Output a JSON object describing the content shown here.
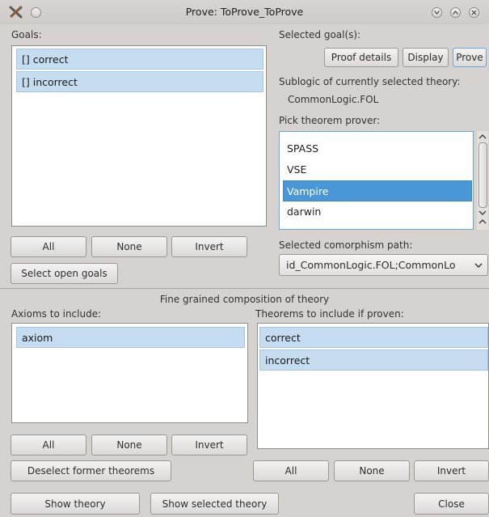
{
  "window": {
    "title": "Prove: ToProve_ToProve"
  },
  "goals": {
    "label": "Goals:",
    "items": [
      "[] correct",
      "[] incorrect"
    ],
    "buttons": {
      "all": "All",
      "none": "None",
      "invert": "Invert",
      "select_open": "Select open goals"
    }
  },
  "selected_goals": {
    "label": "Selected goal(s):",
    "buttons": {
      "proof_details": "Proof details",
      "display": "Display",
      "prove": "Prove"
    }
  },
  "sublogic": {
    "label": "Sublogic of currently selected theory:",
    "value": "CommonLogic.FOL"
  },
  "prover": {
    "label": "Pick theorem prover:",
    "items": [
      "SPASS",
      "VSE",
      "Vampire",
      "darwin"
    ],
    "selected": "Vampire"
  },
  "comorphism": {
    "label": "Selected comorphism path:",
    "value": "id_CommonLogic.FOL;CommonLo"
  },
  "composition": {
    "heading": "Fine grained composition of theory",
    "axioms_label": "Axioms to include:",
    "axioms": [
      "axiom"
    ],
    "axiom_buttons": {
      "all": "All",
      "none": "None",
      "invert": "Invert"
    },
    "deselect_former": "Deselect former theorems",
    "theorems_label": "Theorems to include if proven:",
    "theorems": [
      "correct",
      "incorrect"
    ],
    "theorem_buttons": {
      "all": "All",
      "none": "None",
      "invert": "Invert"
    }
  },
  "footer": {
    "show_theory": "Show theory",
    "show_selected_theory": "Show selected theory",
    "close": "Close"
  },
  "colors": {
    "selection": "#c6dcf1",
    "highlight": "#4a97d8",
    "window_bg": "#d6d2d0"
  },
  "icons": {
    "app": "tools-icon",
    "minimize": "chevron-down-icon",
    "maximize": "chevron-up-icon",
    "close": "close-icon"
  }
}
